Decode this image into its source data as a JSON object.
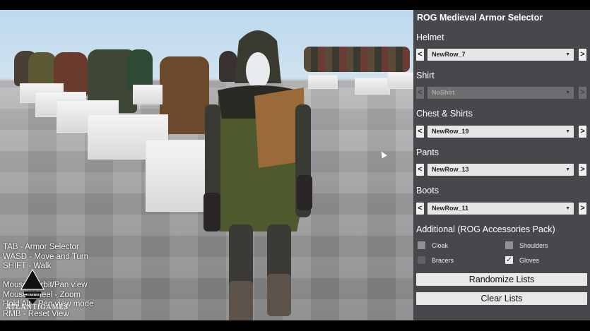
{
  "panel": {
    "title": "ROG Medieval Armor Selector",
    "categories": [
      {
        "label": "Helmet",
        "value": "NewRow_7",
        "enabled": true
      },
      {
        "label": "Shirt",
        "value": "NoShirt",
        "enabled": false
      },
      {
        "label": "Chest & Shirts",
        "value": "NewRow_19",
        "enabled": true
      },
      {
        "label": "Pants",
        "value": "NewRow_13",
        "enabled": true
      },
      {
        "label": "Boots",
        "value": "NewRow_11",
        "enabled": true
      }
    ],
    "prev_glyph": "<",
    "next_glyph": ">",
    "additional_title": "Additional (ROG Accessories Pack)",
    "accessories": [
      {
        "label": "Cloak",
        "checked": false
      },
      {
        "label": "Shoulders",
        "checked": false
      },
      {
        "label": "Bracers",
        "checked": false
      },
      {
        "label": "Gloves",
        "checked": true
      }
    ],
    "check_glyph": "✓",
    "randomize_label": "Randomize Lists",
    "clear_label": "Clear Lists"
  },
  "hud": {
    "lines": [
      "TAB - Armor Selector",
      "WASD - Move and Turn",
      "SHIFT - Walk",
      "",
      "Mouse - Orbit/Pan view",
      "Mouse Wheel - Zoom",
      "Hold Alt - Pan view mode",
      "RMB - Reset View"
    ],
    "logo_text": "ATLANTIGAMES"
  }
}
